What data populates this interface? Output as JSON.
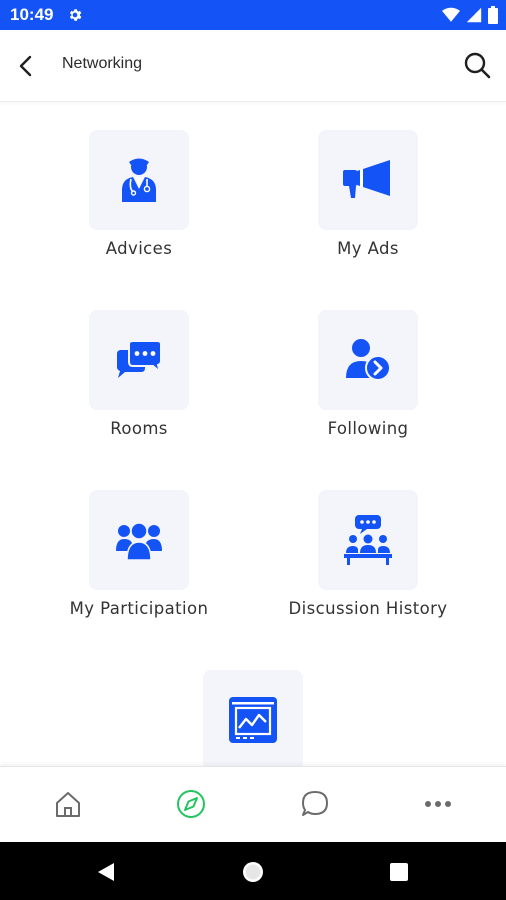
{
  "status_bar": {
    "time": "10:49",
    "icons": [
      "settings-gear-icon",
      "wifi-icon",
      "signal-icon",
      "battery-icon"
    ],
    "background": "#1453f5"
  },
  "app_bar": {
    "title": "Networking",
    "back_icon": "chevron-left-icon",
    "search_icon": "search-icon"
  },
  "menu": {
    "items": [
      {
        "label": "Advices",
        "icon": "doctor-icon"
      },
      {
        "label": "My Ads",
        "icon": "megaphone-icon"
      },
      {
        "label": "Rooms",
        "icon": "chat-bubbles-icon"
      },
      {
        "label": "Following",
        "icon": "user-follow-icon"
      },
      {
        "label": "My Participation",
        "icon": "group-icon"
      },
      {
        "label": "Discussion History",
        "icon": "meeting-icon"
      },
      {
        "label": "",
        "icon": "analytics-screen-icon"
      }
    ]
  },
  "bottom_nav": {
    "items": [
      {
        "name": "home",
        "icon": "home-icon",
        "active": false
      },
      {
        "name": "explore",
        "icon": "compass-icon",
        "active": true
      },
      {
        "name": "chat",
        "icon": "chat-bubble-icon",
        "active": false
      },
      {
        "name": "more",
        "icon": "more-dots-icon",
        "active": false
      }
    ]
  },
  "colors": {
    "accent": "#1453f5",
    "active_nav": "#22c55e",
    "tile_background": "#f3f5fb",
    "inactive_nav": "#6b6b6b"
  }
}
